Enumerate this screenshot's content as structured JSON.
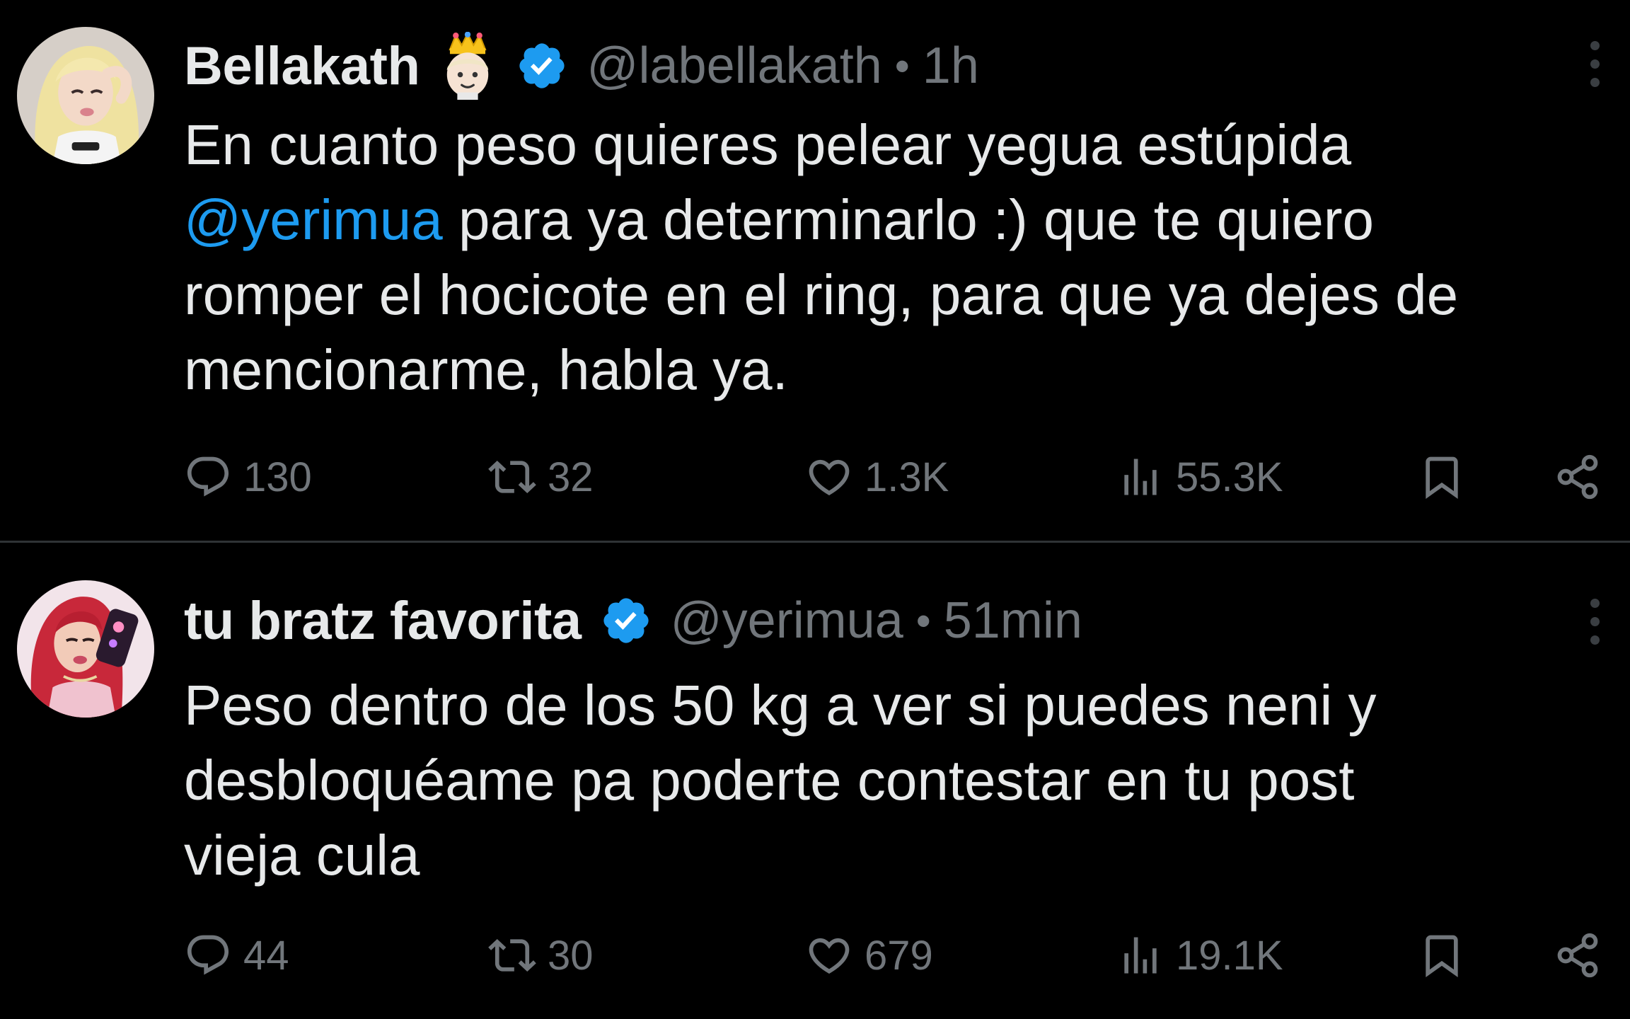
{
  "colors": {
    "background": "#000000",
    "text": "#e7e9ea",
    "muted": "#71767b",
    "accent": "#1d9bf0",
    "divider": "#2f3336"
  },
  "tweets": [
    {
      "display_name": "Bellakath",
      "name_emoji": "princess-emoji-icon",
      "verified": true,
      "handle": "@labellakath",
      "separator": "•",
      "time": "1h",
      "text_lines": [
        [
          "En cuanto peso quieres pelear yegua estúpida"
        ],
        [
          "@yerimua",
          " para ya determinarlo :) que te quiero"
        ],
        [
          "romper el hocicote en el ring, para que ya dejes de"
        ],
        [
          "mencionarme, habla ya."
        ]
      ],
      "mention": "@yerimua",
      "text_rest_line2": " para ya determinarlo :) que te quiero",
      "stats": {
        "replies": "130",
        "reposts": "32",
        "likes": "1.3K",
        "views": "55.3K"
      }
    },
    {
      "display_name": "tu bratz favorita",
      "verified": true,
      "handle": "@yerimua",
      "separator": "•",
      "time": "51min",
      "text_lines": [
        "Peso dentro de los 50 kg a ver si puedes neni y",
        "desbloquéame pa poderte contestar en tu post",
        "vieja cula"
      ],
      "stats": {
        "replies": "44",
        "reposts": "30",
        "likes": "679",
        "views": "19.1K"
      }
    }
  ]
}
